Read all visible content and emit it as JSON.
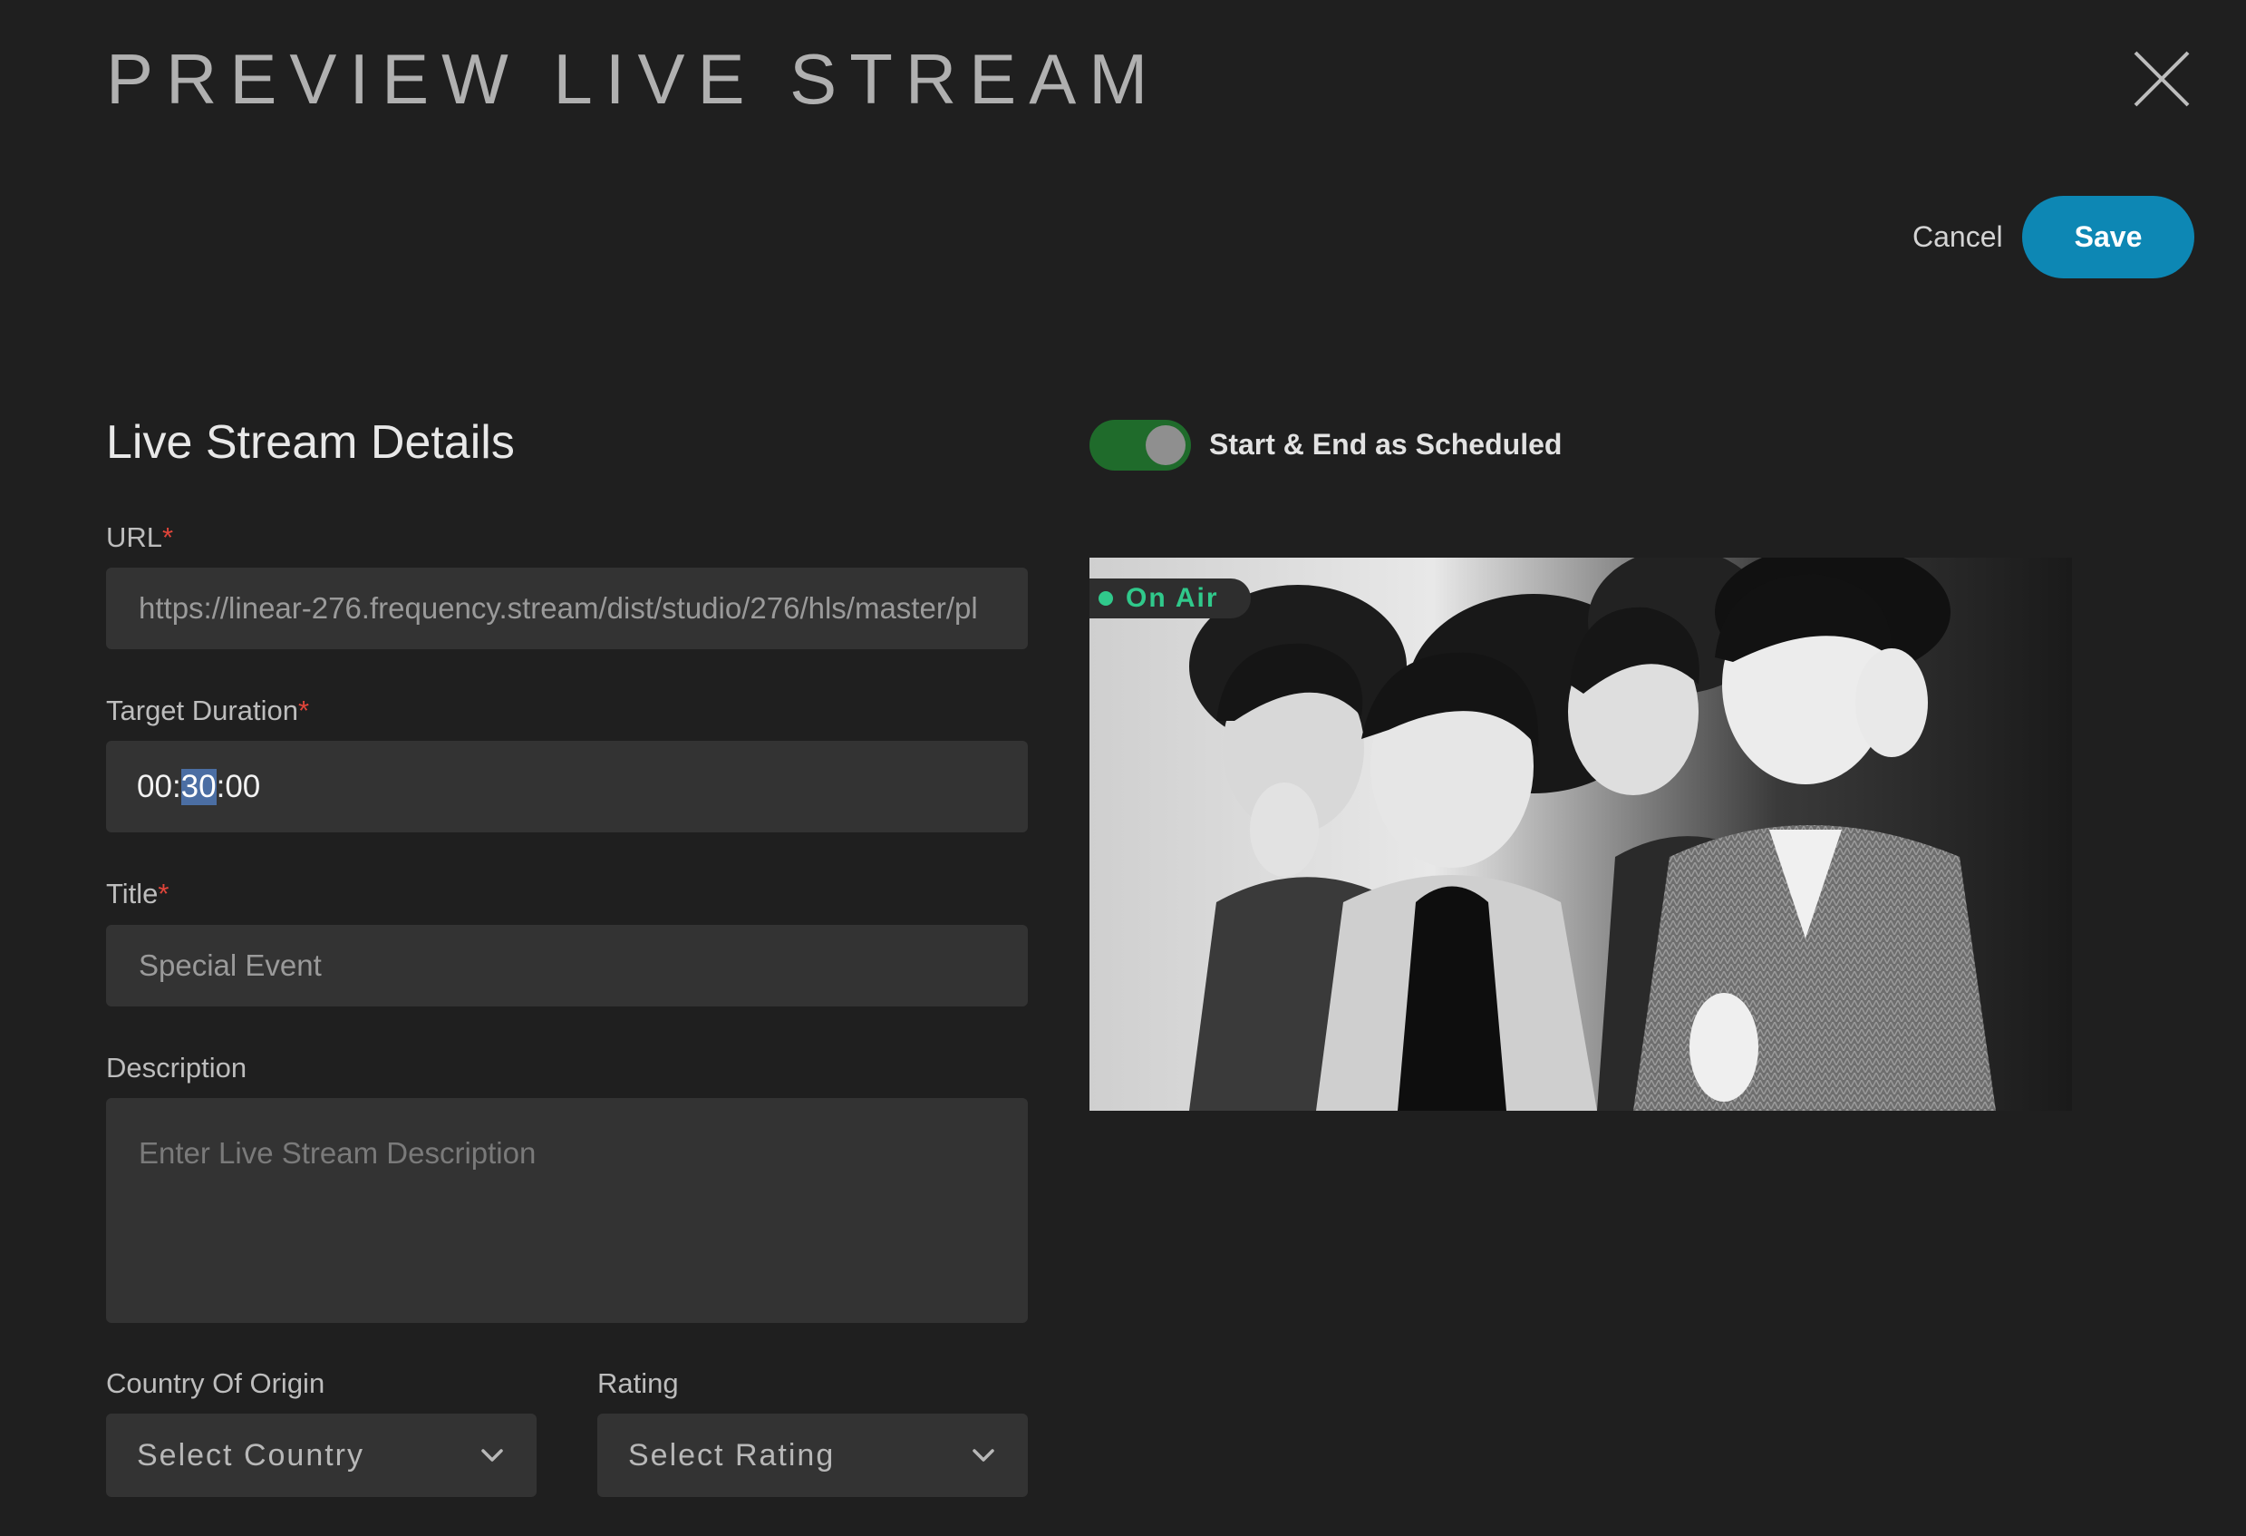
{
  "header": {
    "title": "PREVIEW LIVE STREAM"
  },
  "actions": {
    "cancel_label": "Cancel",
    "save_label": "Save"
  },
  "details": {
    "section_title": "Live Stream Details",
    "url": {
      "label": "URL",
      "required_mark": "*",
      "value": "https://linear-276.frequency.stream/dist/studio/276/hls/master/pl"
    },
    "target_duration": {
      "label": "Target Duration",
      "required_mark": "*",
      "hours": "00",
      "sep1": ":",
      "minutes": "30",
      "sep2": ":",
      "seconds": "00"
    },
    "title": {
      "label": "Title",
      "required_mark": "*",
      "placeholder": "Special Event"
    },
    "description": {
      "label": "Description",
      "placeholder": "Enter Live Stream Description"
    },
    "country": {
      "label": "Country Of Origin",
      "selected": "Select Country"
    },
    "rating": {
      "label": "Rating",
      "selected": "Select Rating"
    }
  },
  "schedule_toggle": {
    "label": "Start & End as Scheduled",
    "on": true
  },
  "preview": {
    "status": "On Air",
    "status_color": "#30c98b"
  },
  "colors": {
    "accent": "#0d87b4",
    "toggle_on": "#1f6b2b",
    "required": "#e0453a"
  },
  "icons": {
    "close": "close-icon",
    "dropdown": "chevron-down-icon"
  }
}
